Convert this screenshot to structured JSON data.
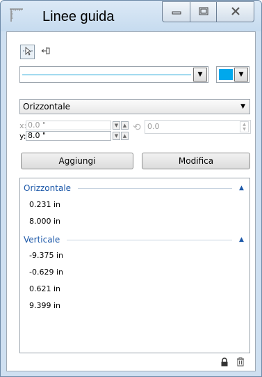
{
  "window": {
    "title": "Linee guida",
    "icon": "guidelines-ruler-icon"
  },
  "toolbar": {
    "tools": [
      "select-guide-icon",
      "snap-guide-icon"
    ]
  },
  "line_style": {
    "line_color": "#1aa3d8",
    "swatch_color": "#00a8ec"
  },
  "orientation": {
    "selected": "Orizzontale"
  },
  "coords": {
    "x_label": "x:",
    "x_value": "0.0 \"",
    "y_label": "y:",
    "y_value": "8.0 \"",
    "rotation_value": "0.0"
  },
  "buttons": {
    "add_label": "Aggiungi",
    "edit_label": "Modifica"
  },
  "list": {
    "groups": [
      {
        "label": "Orizzontale",
        "items": [
          "0.231 in",
          "8.000 in"
        ]
      },
      {
        "label": "Verticale",
        "items": [
          "-9.375 in",
          "-0.629 in",
          "0.621 in",
          "9.399 in"
        ]
      }
    ]
  },
  "footer": {
    "icons": [
      "lock-icon",
      "trash-icon"
    ]
  }
}
